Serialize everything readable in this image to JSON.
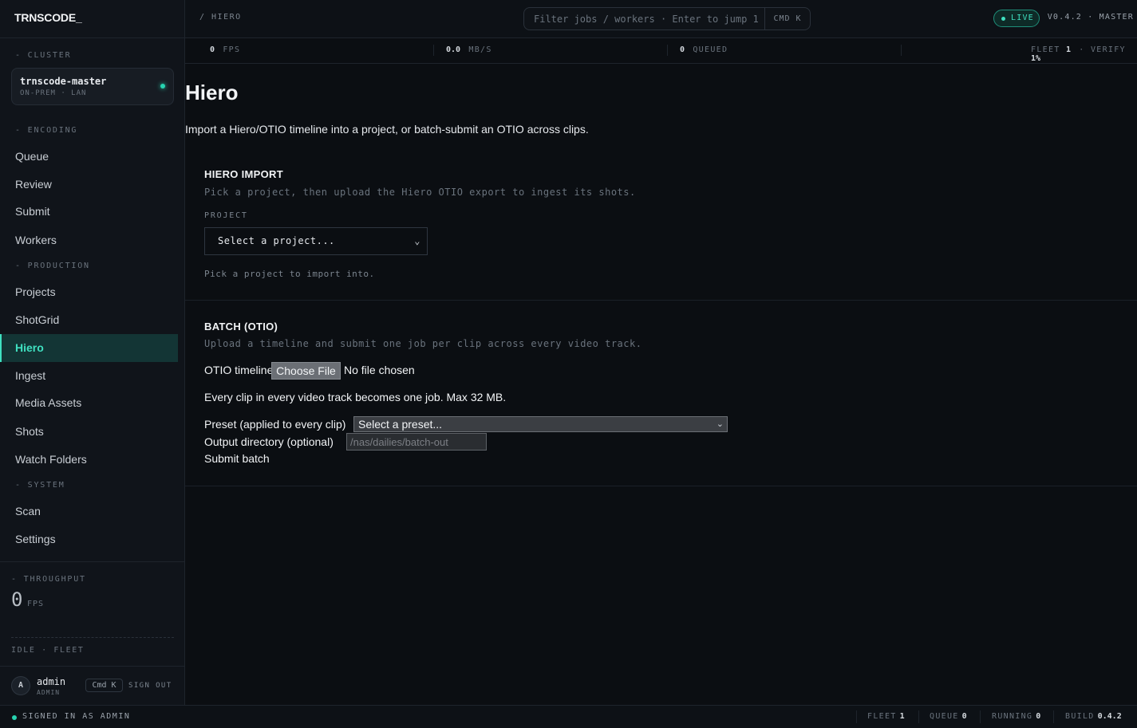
{
  "brand": "TRNSCODE_",
  "breadcrumb": "/ HIERO",
  "search": {
    "placeholder": "Filter jobs / workers · Enter to jump 1",
    "shortcut": "CMD K"
  },
  "live_label": "LIVE",
  "version": "V0.4.2 · MASTER",
  "metrics": {
    "fps_value": "0",
    "fps_unit": "FPS",
    "mbs_value": "0.0",
    "mbs_unit": "MB/S",
    "queued_value": "0",
    "queued_unit": "QUEUED",
    "fleet_label": "FLEET",
    "fleet_value": "1",
    "verify_label": "VERIFY",
    "verify_value": "1%"
  },
  "sidebar": {
    "cluster_label": "- CLUSTER",
    "cluster_name": "trnscode-master",
    "cluster_sub": "ON-PREM · LAN",
    "encoding_label": "- ENCODING",
    "production_label": "- PRODUCTION",
    "system_label": "- SYSTEM",
    "items": [
      "Queue",
      "Review",
      "Submit",
      "Workers",
      "Projects",
      "ShotGrid",
      "Hiero",
      "Ingest",
      "Media Assets",
      "Shots",
      "Watch Folders",
      "Scan",
      "Settings"
    ],
    "active_item": "Hiero",
    "throughput_label": "- THROUGHPUT",
    "throughput_value": "0",
    "throughput_unit": "FPS",
    "idle_fleet": "IDLE · FLEET",
    "user_initial": "A",
    "user_name": "admin",
    "user_role": "ADMIN",
    "shortcut": "Cmd K",
    "sign_out": "SIGN OUT"
  },
  "page": {
    "title": "Hiero",
    "description": "Import a Hiero/OTIO timeline into a project, or batch-submit an OTIO across clips."
  },
  "hiero_import": {
    "title": "HIERO IMPORT",
    "subtitle": "Pick a project, then upload the Hiero OTIO export to ingest its shots.",
    "project_label": "PROJECT",
    "project_select": "Select a project...",
    "hint": "Pick a project to import into."
  },
  "batch": {
    "title": "BATCH (OTIO)",
    "subtitle": "Upload a timeline and submit one job per clip across every video track.",
    "otio_label": "OTIO timeline",
    "choose_file": "Choose File",
    "file_status": "No file chosen",
    "note": "Every clip in every video track becomes one job. Max 32 MB.",
    "preset_label": "Preset (applied to every clip)",
    "preset_select": "Select a preset...",
    "output_label": "Output directory (optional)",
    "output_placeholder": "/nas/dailies/batch-out",
    "submit": "Submit batch"
  },
  "statusbar": {
    "signed_in": "SIGNED IN AS ADMIN",
    "fleet_label": "FLEET",
    "fleet_value": "1",
    "queue_label": "QUEUE",
    "queue_value": "0",
    "running_label": "RUNNING",
    "running_value": "0",
    "build_label": "BUILD",
    "build_value": "0.4.2"
  },
  "colors": {
    "accent": "#3fe0c0",
    "background": "#0b0e12",
    "sidebar": "#10141a"
  }
}
